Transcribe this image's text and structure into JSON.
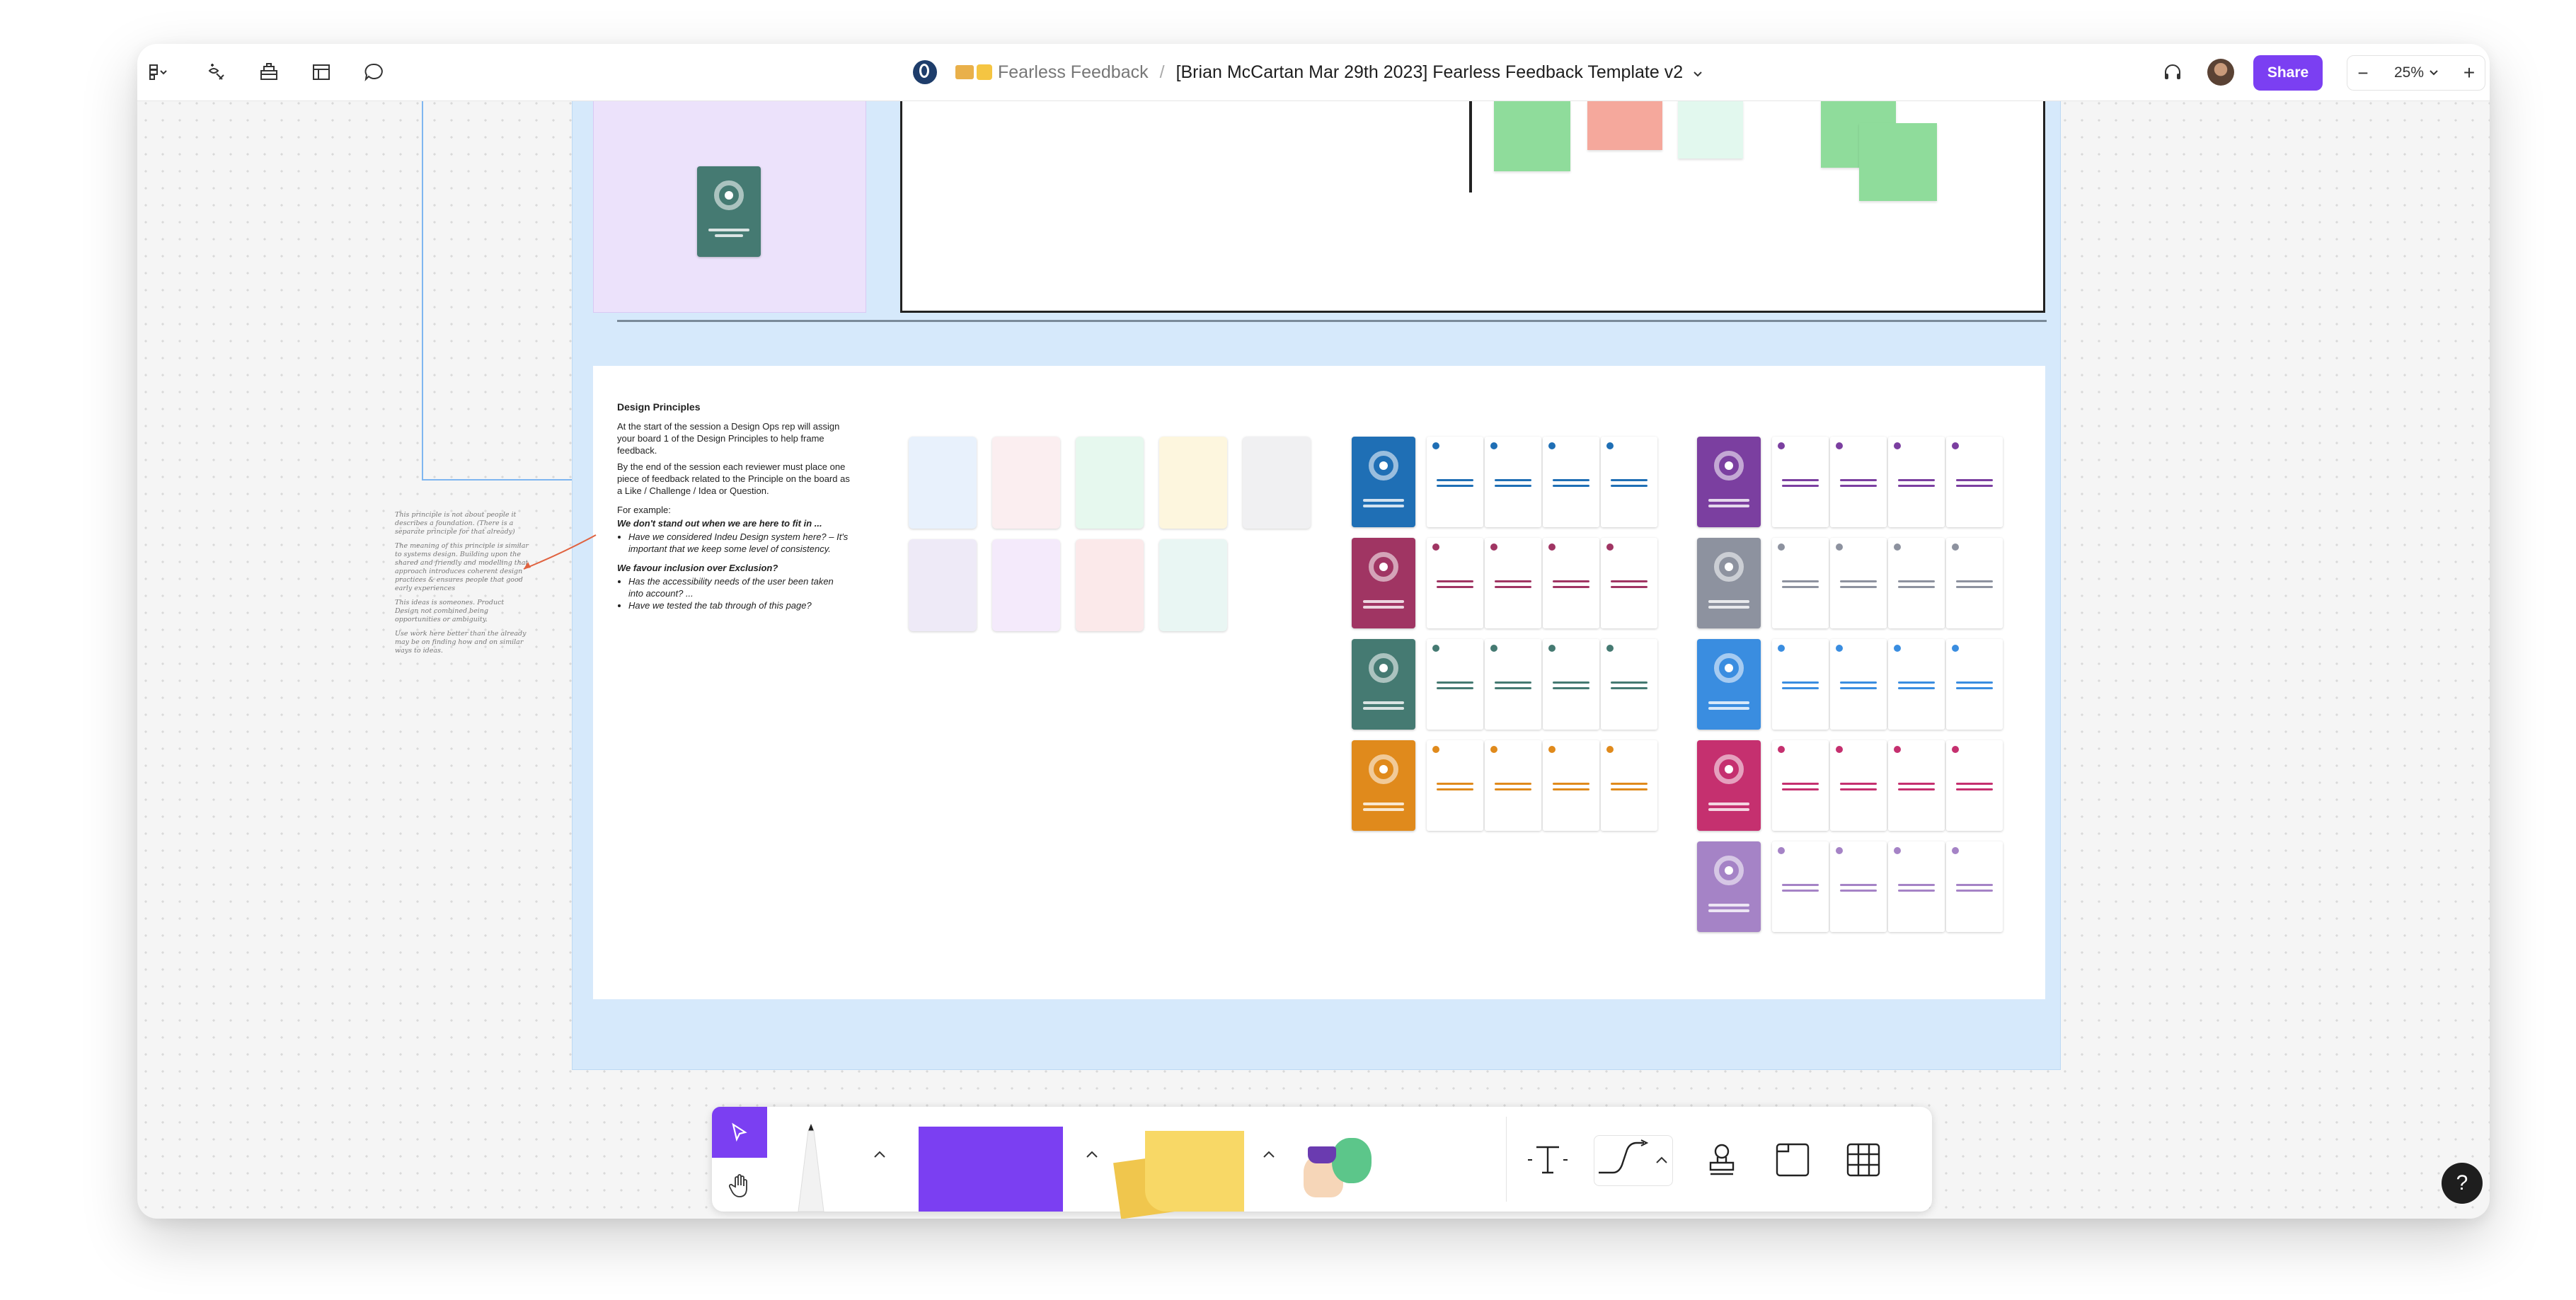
{
  "topbar": {
    "breadcrumb_project": "Fearless Feedback",
    "breadcrumb_separator": "/",
    "file_name": "[Brian McCartan Mar 29th 2023] Fearless Feedback Template v2",
    "share_label": "Share",
    "zoom_level": "25%",
    "zoom_out": "−",
    "zoom_in": "+"
  },
  "board": {
    "principles_title": "Design Principles",
    "principles_intro": "At the start of the session a Design Ops rep will assign your board 1 of the Design Principles to help frame feedback.",
    "principles_body": "By the end of the session each reviewer must place one piece of feedback related to the Principle on the board as a Like / Challenge / Idea or Question.",
    "for_example": "For example:",
    "example1_title": "We don't stand out when we are here to fit in ...",
    "example1_items": [
      "Have we considered Indeu Design system here? – It's important that we keep some level of consistency."
    ],
    "example2_title": "We favour inclusion over Exclusion?",
    "example2_items": [
      "Has the accessibility needs of the user been taken into account? ...",
      "Have we tested the tab through of this page?"
    ],
    "handwritten_notes": [
      "This principle is not about people it describes a foundation. (There is a separate principle for that already)",
      "The meaning of this principle is similar to systems design. Building upon the shared and friendly and modelling that approach introduces coherent design practices & ensures people that good early experiences",
      "This ideas is someones. Product Design not combined being opportunities or ambiguity.",
      "Use work here better than the already may be on finding how and on similar ways to ideas."
    ]
  },
  "help_label": "?",
  "colors": {
    "accent": "#7b3ff2",
    "frame_blue": "#d6e9fb",
    "frame_purple": "#ece2fb",
    "sticky_green": "#8fdc9b",
    "sticky_red": "#f5a89c",
    "sticky_mint": "#e2f8ee",
    "card_blue": "#1f6fb5",
    "card_plum": "#a03563",
    "card_teal": "#457a72",
    "card_orange": "#e08a1c",
    "card_violet": "#7b3fa0",
    "card_grey": "#8d929f",
    "card_sky": "#3a8de0",
    "card_pink": "#c5306f",
    "card_lilac": "#a583c6"
  }
}
